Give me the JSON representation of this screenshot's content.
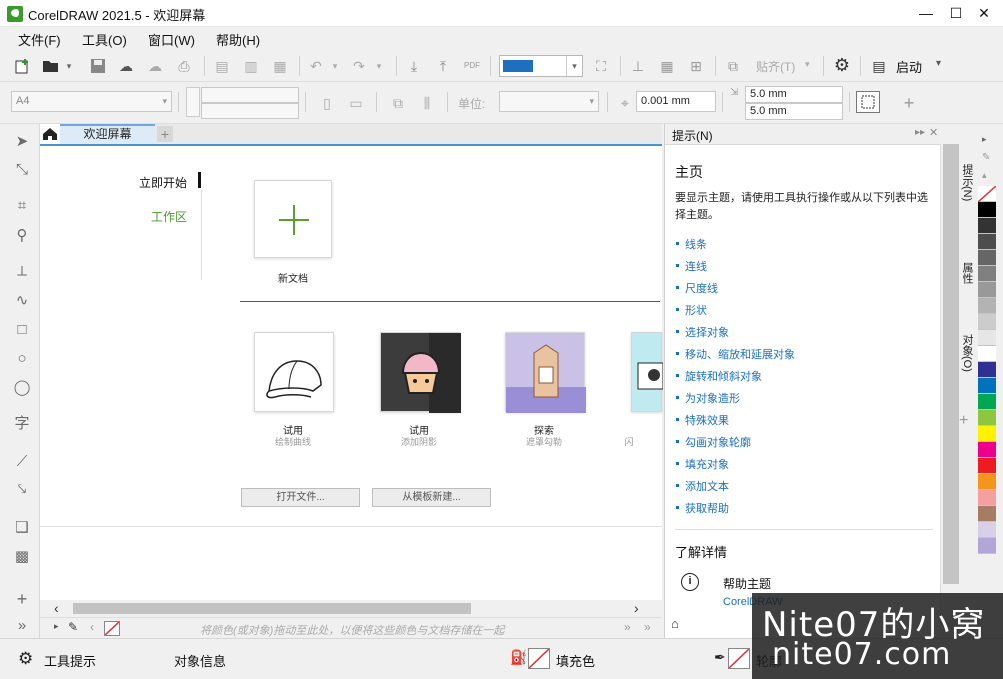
{
  "window": {
    "title": "CorelDRAW 2021.5 - 欢迎屏幕",
    "minimize": "—",
    "maximize": "☐",
    "close": "✕"
  },
  "menu": [
    "文件(F)",
    "工具(O)",
    "窗口(W)",
    "帮助(H)"
  ],
  "toolbar": {
    "snap_label": "贴齐(T)",
    "launch_label": "启动",
    "unit_label": "单位:",
    "page_size": "A4",
    "nudge": "0.001 mm",
    "dup_x": "5.0 mm",
    "dup_y": "5.0 mm",
    "zoom_color": "#1f6fbf"
  },
  "tabs": {
    "welcome": "欢迎屏幕"
  },
  "welcome": {
    "nav": [
      {
        "label": "立即开始",
        "active": true
      },
      {
        "label": "工作区",
        "active": false
      }
    ],
    "new_doc": "新文档",
    "cards": [
      {
        "title": "试用",
        "sub": "绘制曲线"
      },
      {
        "title": "试用",
        "sub": "添加阴影"
      },
      {
        "title": "探索",
        "sub": "遮罩勾勒"
      },
      {
        "title": "",
        "sub": "闪"
      }
    ],
    "open_file": "打开文件...",
    "from_template": "从模板新建..."
  },
  "palette_hint": "将颜色(或对象)拖动至此处，以便将这些颜色与文档存储在一起",
  "hints": {
    "header": "提示(N)",
    "heading": "主页",
    "intro": "要显示主题，请使用工具执行操作或从以下列表中选择主题。",
    "links": [
      "线条",
      "连线",
      "尺度线",
      "形状",
      "选择对象",
      "移动、缩放和延展对象",
      "旋转和倾斜对象",
      "为对象造形",
      "特殊效果",
      "勾画对象轮廓",
      "填充对象",
      "添加文本",
      "获取帮助"
    ],
    "more_heading": "了解详情",
    "help_topics": "帮助主题",
    "help_sub": "CorelDRAW"
  },
  "docker_tabs": [
    "提示(N)",
    "属性",
    "对象(O)"
  ],
  "palette_colors": [
    "#000000",
    "#333333",
    "#4d4d4d",
    "#666666",
    "#808080",
    "#999999",
    "#b3b3b3",
    "#cccccc",
    "#e6e6e6",
    "#ffffff",
    "#2e3192",
    "#0072bc",
    "#00a651",
    "#8dc63f",
    "#fff200",
    "#ec008c",
    "#ed1c24",
    "#f7941d",
    "#f5a0a0",
    "#a57d62",
    "#d8d0e8",
    "#b3a6d6"
  ],
  "status": {
    "tool_hints": "工具提示",
    "object_info": "对象信息",
    "fill": "填充色",
    "outline": "轮廓"
  },
  "watermark": {
    "line1": "Nite07的小窝",
    "line2": "nite07.com"
  }
}
